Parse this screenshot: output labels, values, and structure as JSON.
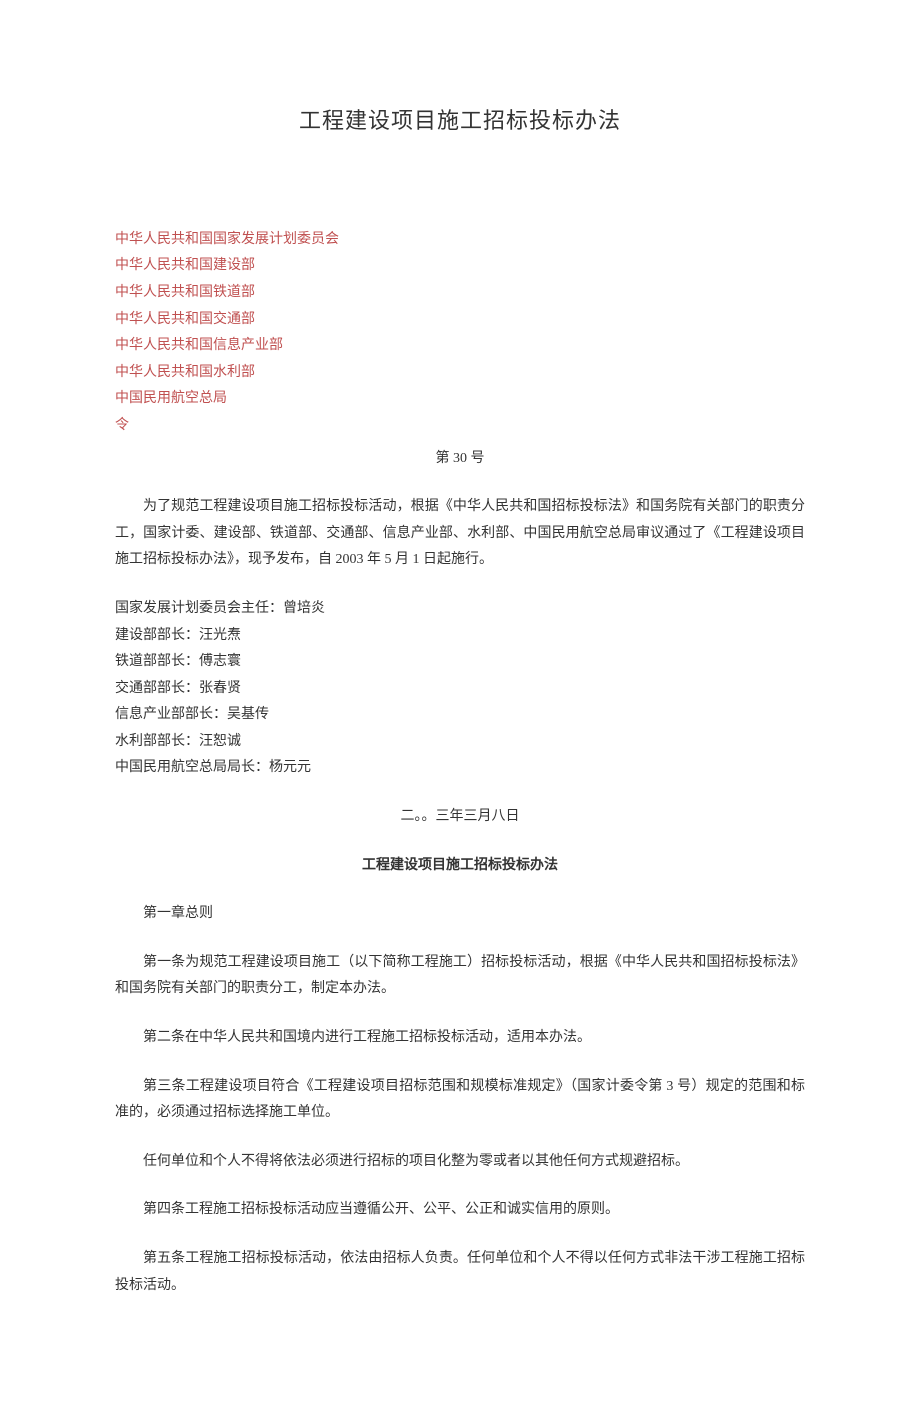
{
  "title": "工程建设项目施工招标投标办法",
  "issuers": [
    "中华人民共和国国家发展计划委员会",
    "中华人民共和国建设部",
    "中华人民共和国铁道部",
    "中华人民共和国交通部",
    "中华人民共和国信息产业部",
    "中华人民共和国水利部",
    "中国民用航空总局",
    "令"
  ],
  "decree_number": "第 30 号",
  "intro_paragraph": "为了规范工程建设项目施工招标投标活动，根据《中华人民共和国招标投标法》和国务院有关部门的职责分工，国家计委、建设部、铁道部、交通部、信息产业部、水利部、中国民用航空总局审议通过了《工程建设项目施工招标投标办法》，现予发布，自 2003 年 5 月 1 日起施行。",
  "signatories": [
    "国家发展计划委员会主任：曾培炎",
    "建设部部长：汪光焘",
    "铁道部部长：傅志寰",
    "交通部部长：张春贤",
    "信息产业部部长：吴基传",
    "水利部部长：汪恕诚",
    "中国民用航空总局局长：杨元元"
  ],
  "issue_date": "二。。三年三月八日",
  "regulation_title": "工程建设项目施工招标投标办法",
  "chapter_heading": "第一章总则",
  "articles": [
    "第一条为规范工程建设项目施工（以下简称工程施工）招标投标活动，根据《中华人民共和国招标投标法》和国务院有关部门的职责分工，制定本办法。",
    "第二条在中华人民共和国境内进行工程施工招标投标活动，适用本办法。",
    "第三条工程建设项目符合《工程建设项目招标范围和规模标准规定》（国家计委令第 3 号）规定的范围和标准的，必须通过招标选择施工单位。",
    "任何单位和个人不得将依法必须进行招标的项目化整为零或者以其他任何方式规避招标。",
    "第四条工程施工招标投标活动应当遵循公开、公平、公正和诚实信用的原则。",
    "第五条工程施工招标投标活动，依法由招标人负责。任何单位和个人不得以任何方式非法干涉工程施工招标投标活动。"
  ]
}
